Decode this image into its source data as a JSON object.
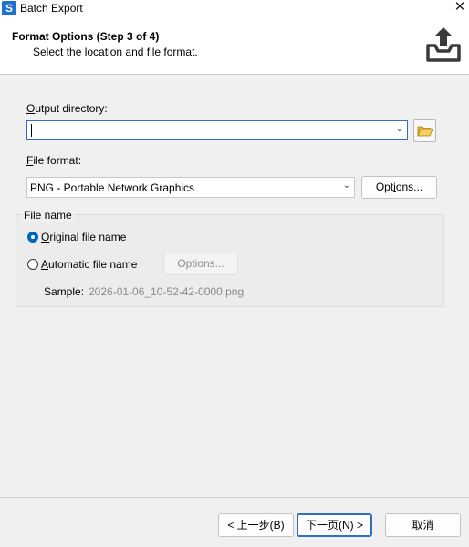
{
  "window": {
    "title": "Batch Export",
    "app_icon_letter": "S"
  },
  "header": {
    "title": "Format Options (Step 3 of 4)",
    "subtitle": "Select the location and file format."
  },
  "output_directory": {
    "label_accel": "O",
    "label_rest": "utput directory:",
    "value": ""
  },
  "file_format": {
    "label_accel": "F",
    "label_rest": "ile format:",
    "selected": "PNG - Portable Network Graphics",
    "options_label_pre": "Opt",
    "options_label_accel": "i",
    "options_label_post": "ons..."
  },
  "file_name": {
    "group_title": "File name",
    "original_pre": "",
    "original_accel": "O",
    "original_post": "riginal file name",
    "automatic_pre": "",
    "automatic_accel": "A",
    "automatic_post": "utomatic file name",
    "options_label": "Options...",
    "sample_label": "Sample:",
    "sample_value": "2026-01-06_10-52-42-0000.png",
    "selected": "original"
  },
  "footer": {
    "back_label": "< 上一步(B)",
    "next_label": "下一页(N) >",
    "cancel_label": "取消"
  },
  "colors": {
    "accent": "#0067c0",
    "export_icon": "#3a3a3a"
  }
}
